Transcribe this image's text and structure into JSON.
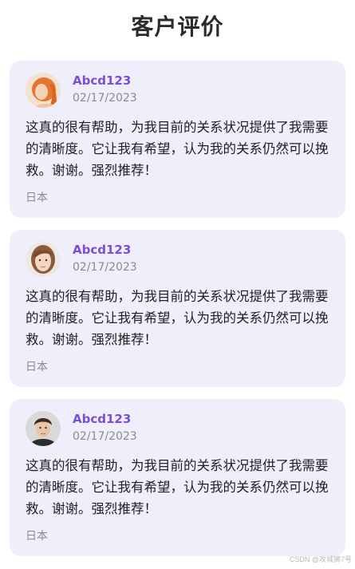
{
  "header": {
    "title": "客户评价"
  },
  "reviews": [
    {
      "name": "Abcd123",
      "date": "02/17/2023",
      "text": "这真的很有帮助，为我目前的关系状况提供了我需要的清晰度。它让我有希望，认为我的关系仍然可以挽救。谢谢。强烈推荐！",
      "country": "日本",
      "avatar": "avatar-red-hair-woman"
    },
    {
      "name": "Abcd123",
      "date": "02/17/2023",
      "text": "这真的很有帮助，为我目前的关系状况提供了我需要的清晰度。它让我有希望，认为我的关系仍然可以挽救。谢谢。强烈推荐！",
      "country": "日本",
      "avatar": "avatar-brown-hair-woman"
    },
    {
      "name": "Abcd123",
      "date": "02/17/2023",
      "text": "这真的很有帮助，为我目前的关系状况提供了我需要的清晰度。它让我有希望，认为我的关系仍然可以挽救。谢谢。强烈推荐！",
      "country": "日本",
      "avatar": "avatar-man"
    }
  ],
  "watermark": "CSDN @攻城狮7号",
  "colors": {
    "card_bg": "#f1eefb",
    "name": "#7a4fd6",
    "muted": "#8a8a8a"
  }
}
